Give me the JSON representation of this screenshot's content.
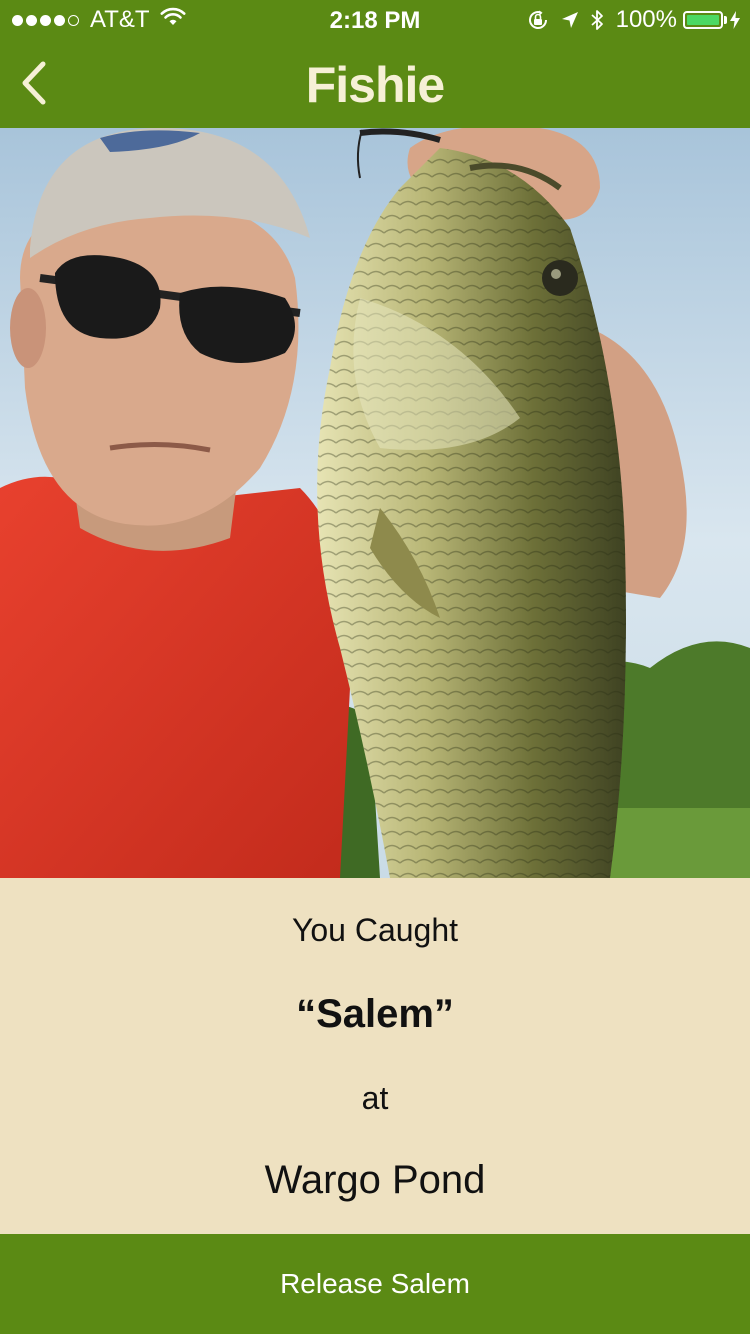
{
  "status_bar": {
    "carrier": "AT&T",
    "time": "2:18 PM",
    "battery_percent": "100%",
    "battery_level": 1.0,
    "icons": [
      "signal-dots",
      "wifi-icon",
      "orientation-lock-icon",
      "location-arrow-icon",
      "bluetooth-icon",
      "battery-icon",
      "charging-bolt-icon"
    ]
  },
  "nav": {
    "title": "Fishie",
    "back_icon": "chevron-left-icon"
  },
  "photo": {
    "subject": "catch-photo"
  },
  "catch": {
    "intro": "You Caught",
    "fish_name": "“Salem”",
    "at": "at",
    "location": "Wargo Pond"
  },
  "actions": {
    "release_label": "Release Salem"
  },
  "colors": {
    "bar_green": "#5b8a14",
    "title_cream": "#f6f0d6",
    "panel_beige": "#eee1c1",
    "battery_green": "#4cd964"
  }
}
